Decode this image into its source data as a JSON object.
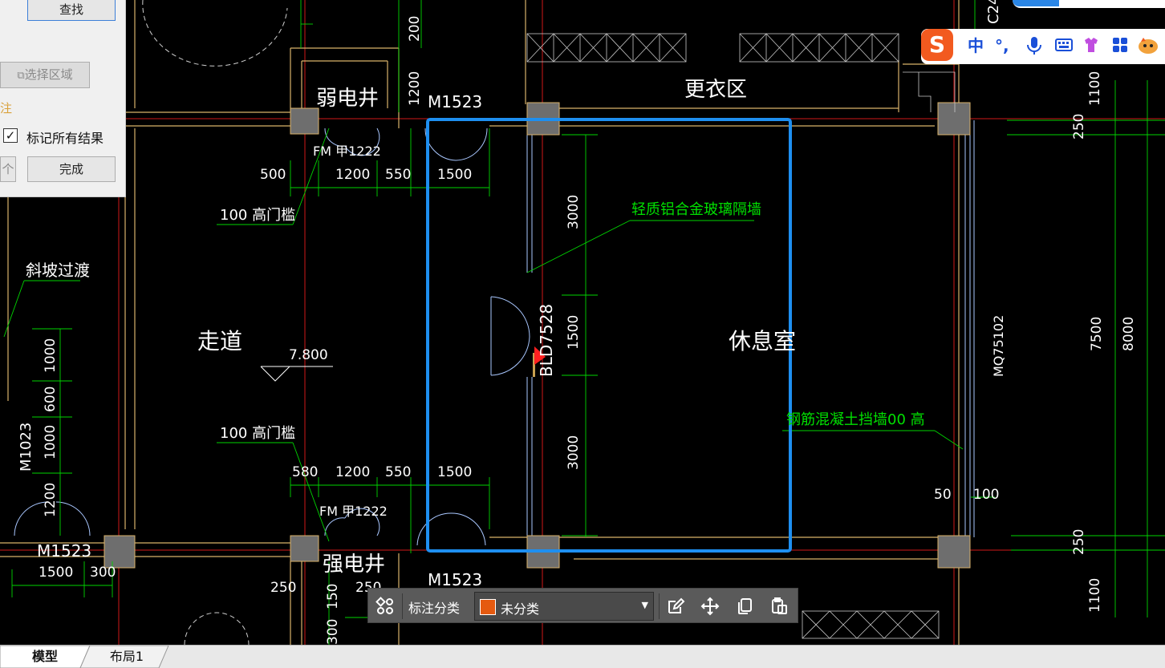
{
  "find_panel": {
    "find_button": "查找",
    "select_area_button": "选择区域",
    "note_label": "注",
    "mark_all_label": "标记所有结果",
    "mark_all_checked": true,
    "count_button": "个",
    "done_button": "完成"
  },
  "drawing": {
    "rooms": {
      "weak_shaft": "弱电井",
      "locker": "更衣区",
      "corridor": "走道",
      "lounge": "休息室",
      "strong_shaft": "强电井",
      "ramp": "斜坡过渡"
    },
    "doors": {
      "m1523_top": "M1523",
      "m1523_bottom": "M1523",
      "m1523_left": "M1523",
      "fm_top": "FM 甲1222",
      "fm_bottom": "FM 甲1222",
      "m1023": "M1023",
      "bld": "BLD7528",
      "mq": "MQ75102",
      "c24": "C24"
    },
    "notes": {
      "threshold_top": "100  高门槛",
      "threshold_bottom": "100  高门槛",
      "glass_wall": "轻质铝合金玻璃隔墙",
      "concrete_wall": "钢筋混凝土挡墙00  高"
    },
    "elevation": "7.800",
    "dims": {
      "d200": "200",
      "d1200_shaft": "1200",
      "d500_t": "500",
      "d1200_t": "1200",
      "d550_t": "550",
      "d1500_t": "1500",
      "d3000_t": "3000",
      "d1500_m": "1500",
      "d3000_b": "3000",
      "d580_b": "580",
      "d1200_b": "1200",
      "d550_b": "550",
      "d1500_b": "1500",
      "d1000_a": "1000",
      "d600": "600",
      "d1000_b": "1000",
      "d1200_l": "1200",
      "d1500_l": "1500",
      "d300_l": "300",
      "d250_a": "250",
      "d250_b": "250",
      "d150": "150",
      "d300_v": "300",
      "d1100_r": "1100",
      "d250_r": "250",
      "d7500": "7500",
      "d8000": "8000",
      "d250_rb": "250",
      "d1100_rb": "1100",
      "d50": "50",
      "d100": "100"
    }
  },
  "ime_bar": {
    "logo": "S",
    "lang": "中",
    "punct": "°,"
  },
  "toolbar": {
    "label": "标注分类",
    "category": "未分类",
    "swatch_color": "#e55a10"
  },
  "tabs": {
    "model": "模型",
    "layout1": "布局1"
  },
  "colors": {
    "wall": "#d9b26a",
    "dim": "#00d400",
    "text": "#ffffff",
    "selection": "#1e8ff0",
    "door": "#a9c7ff",
    "column": "#6e6e6e",
    "axis": "#d01818",
    "marker": "#ff2020"
  }
}
